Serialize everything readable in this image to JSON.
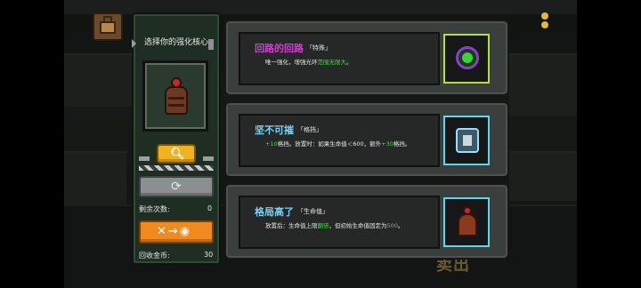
{
  "panel": {
    "title": "选择你的强化核心",
    "remaining_label": "剩余次数:",
    "remaining_value": "0",
    "recycle_label": "回收金币:",
    "recycle_value": "30"
  },
  "background": {
    "sell_text": "卖出"
  },
  "cards": [
    {
      "name": "回路的回路",
      "name_color": "#d23ad2",
      "tag": "「特殊」",
      "desc_prefix": "唯一强化，增强光环",
      "desc_green": "范围无限大",
      "desc_suffix": "。",
      "thumb_icon": "green-orb-icon",
      "thumb_border": "#b8e030"
    },
    {
      "name": "坚不可摧",
      "name_color": "#7ad0f0",
      "tag": "「格挡」",
      "desc_prefix": "",
      "desc_green": "+10",
      "desc_suffix": "格挡。放置时：如果生命值＜600，额外",
      "desc_green2": "+30",
      "desc_suffix2": "格挡。",
      "thumb_icon": "shield-tile-icon",
      "thumb_border": "#5ad8f0"
    },
    {
      "name": "格局高了",
      "name_color": "#7ad0f0",
      "tag": "「生命值」",
      "desc_prefix": "放置后：生命值上限",
      "desc_green": "翻倍",
      "desc_suffix": "，但初始生命值固定为",
      "desc_green2": "500",
      "desc_suffix2": "。",
      "thumb_icon": "caped-figure-icon",
      "thumb_border": "#5ad8f0"
    }
  ],
  "colors": {
    "panel_bg": "#1e2e22",
    "search_button": "#f0b21e",
    "reroll_button": "#8a8f8f",
    "recycle_button": "#f08a1e",
    "highlight_green": "#3fdc3f"
  }
}
